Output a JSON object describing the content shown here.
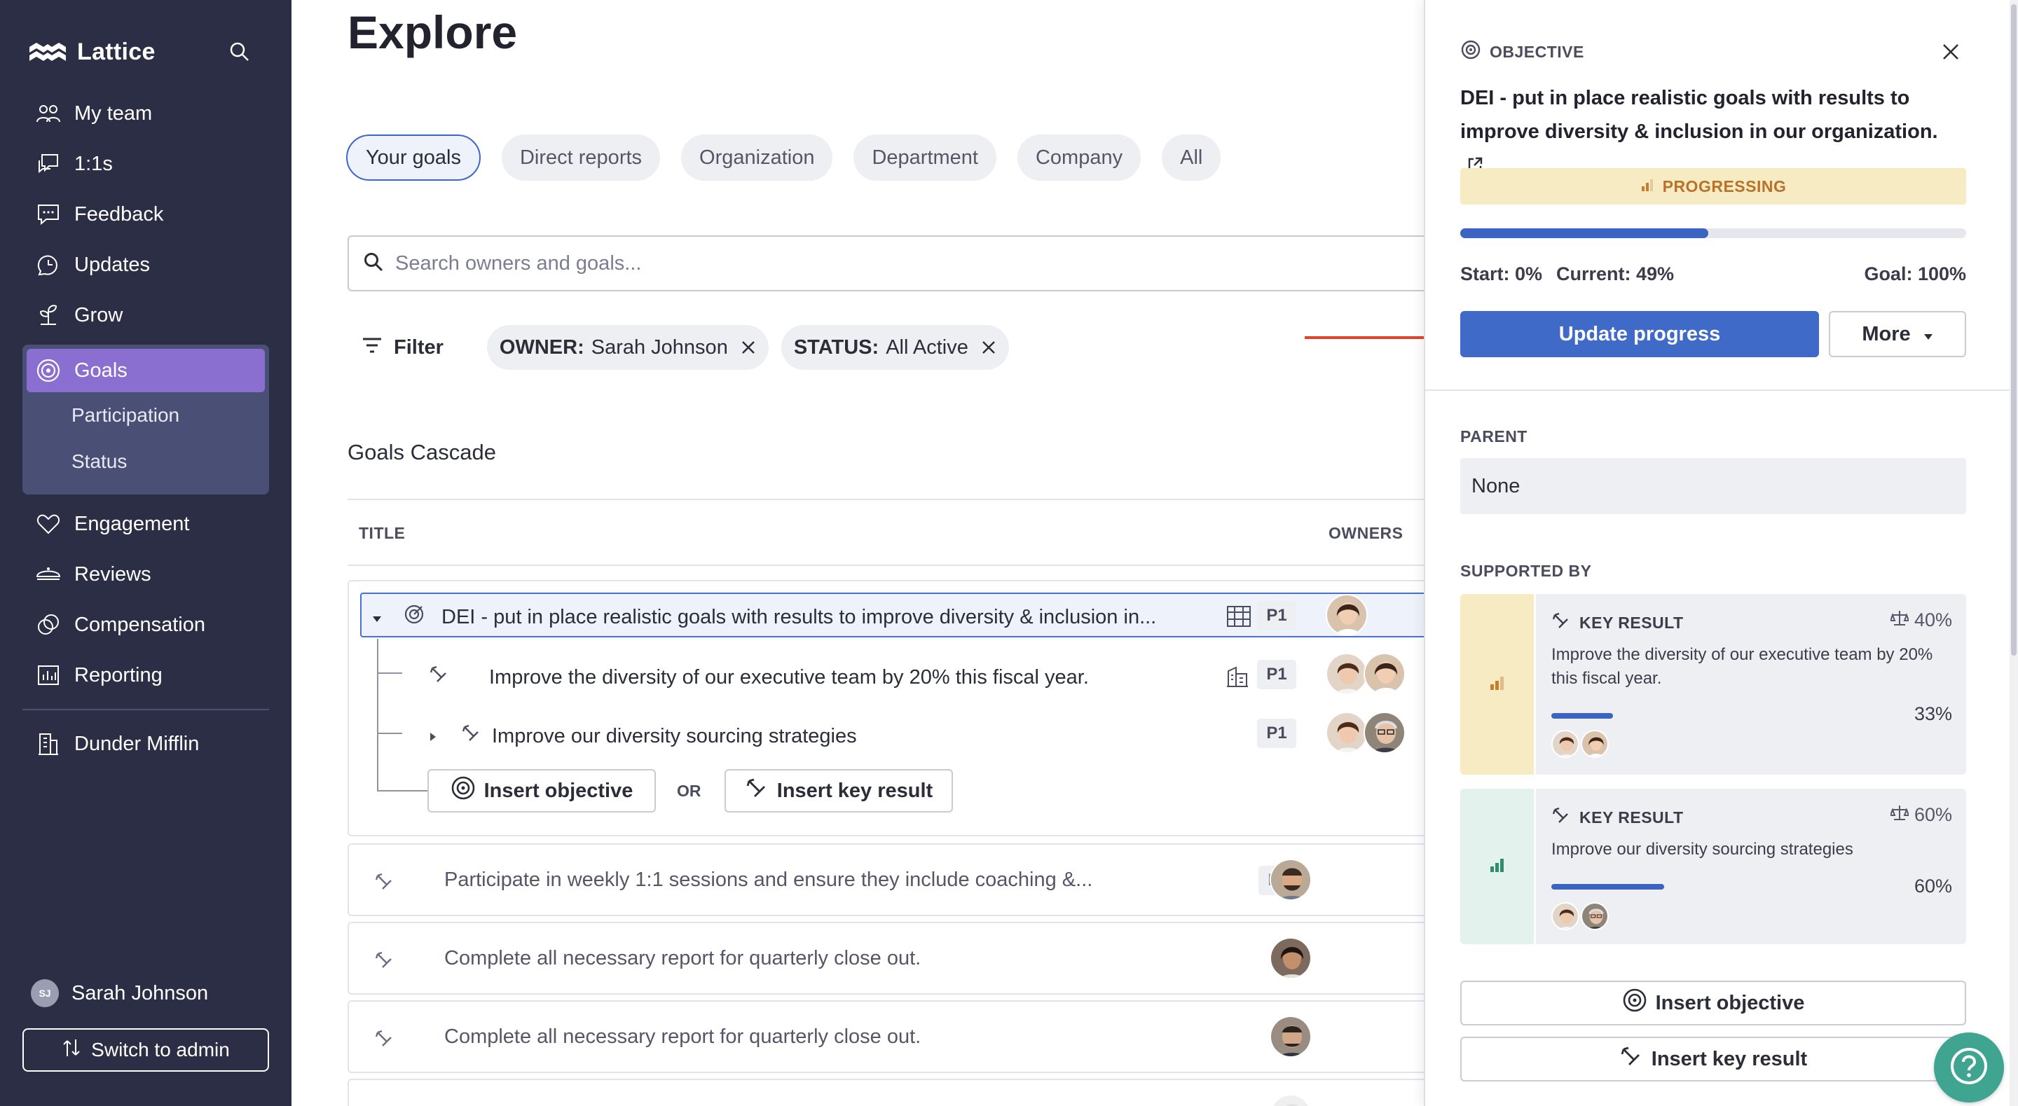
{
  "sidebar": {
    "brand": "Lattice",
    "nav": [
      {
        "label": "My team",
        "icon": "team-icon"
      },
      {
        "label": "1:1s",
        "icon": "chat-bubbles-icon"
      },
      {
        "label": "Feedback",
        "icon": "feedback-icon"
      },
      {
        "label": "Updates",
        "icon": "updates-icon"
      },
      {
        "label": "Grow",
        "icon": "grow-icon"
      }
    ],
    "goals": {
      "label": "Goals",
      "sub": [
        "Participation",
        "Status"
      ]
    },
    "nav2": [
      {
        "label": "Engagement",
        "icon": "heart-icon"
      },
      {
        "label": "Reviews",
        "icon": "reviews-icon"
      },
      {
        "label": "Compensation",
        "icon": "compensation-icon"
      },
      {
        "label": "Reporting",
        "icon": "reporting-icon"
      }
    ],
    "company": "Dunder Mifflin",
    "user": {
      "initials": "SJ",
      "name": "Sarah Johnson"
    },
    "switch_admin": "Switch to admin"
  },
  "main": {
    "title": "Explore",
    "tabs": [
      "Your goals",
      "Direct reports",
      "Organization",
      "Department",
      "Company",
      "All"
    ],
    "active_tab": "Your goals",
    "search_placeholder": "Search owners and goals...",
    "filter_label": "Filter",
    "chips": [
      {
        "key": "OWNER:",
        "value": "Sarah Johnson"
      },
      {
        "key": "STATUS:",
        "value": "All Active"
      }
    ],
    "cascade_title": "Goals Cascade",
    "columns": {
      "title": "TITLE",
      "owners": "OWNERS"
    },
    "rows": [
      {
        "title": "DEI - put in place realistic goals with results to improve diversity & inclusion in...",
        "priority": "P1"
      },
      {
        "title": "Improve the diversity of our executive team by 20% this fiscal year.",
        "priority": "P1"
      },
      {
        "title": "Improve our diversity sourcing strategies",
        "priority": "P1"
      }
    ],
    "insert_objective": "Insert objective",
    "or_label": "OR",
    "insert_key_result": "Insert key result",
    "other_rows": [
      {
        "title": "Participate in weekly 1:1 sessions and ensure they include coaching &...",
        "priority": "P2"
      },
      {
        "title": "Complete all necessary report for quarterly close out.",
        "priority": ""
      },
      {
        "title": "Complete all necessary report for quarterly close out.",
        "priority": ""
      }
    ]
  },
  "panel": {
    "kicker": "OBJECTIVE",
    "title": "DEI - put in place realistic goals with results to improve diversity & inclusion in our organization.",
    "status": "PROGRESSING",
    "progress": 0.49,
    "start": "Start: 0%",
    "current": "Current: 49%",
    "goal": "Goal: 100%",
    "update_btn": "Update progress",
    "more_btn": "More",
    "parent_label": "PARENT",
    "parent_value": "None",
    "supported_label": "SUPPORTED BY",
    "key_results": [
      {
        "kicker": "KEY RESULT",
        "weight": "40%",
        "text": "Improve the diversity of our executive team by 20% this fiscal year.",
        "progress": 0.33,
        "pct": "33%",
        "stripe_color": "#f6ebc3",
        "status_color": "#c77c2e"
      },
      {
        "kicker": "KEY RESULT",
        "weight": "60%",
        "text": "Improve our diversity sourcing strategies",
        "progress": 0.6,
        "pct": "60%",
        "stripe_color": "#e3f2ec",
        "status_color": "#2f8e6b"
      }
    ],
    "insert_objective": "Insert objective",
    "insert_key_result": "Insert key result"
  },
  "colors": {
    "accent": "#3f6ac8",
    "sidebar": "#2b2e45",
    "goals_active": "#8a6fd1",
    "help": "#3fa590",
    "arrow": "#e0442f"
  }
}
